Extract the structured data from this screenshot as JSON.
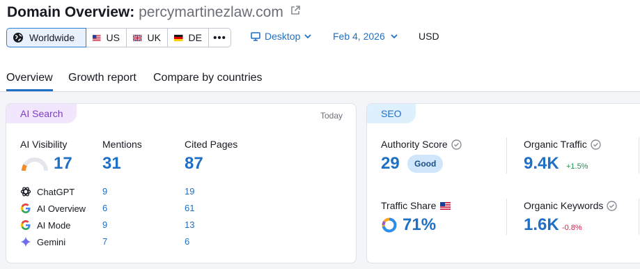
{
  "header": {
    "title": "Domain Overview:",
    "domain": "percymartinezlaw.com"
  },
  "databases": {
    "worldwide": "Worldwide",
    "us": "US",
    "uk": "UK",
    "de": "DE",
    "more": "•••"
  },
  "filters": {
    "device": "Desktop",
    "date": "Feb 4, 2026",
    "currency": "USD"
  },
  "tabs": {
    "overview": "Overview",
    "growth": "Growth report",
    "compare": "Compare by countries"
  },
  "ai_search": {
    "tag": "AI Search",
    "period": "Today",
    "visibility_label": "AI Visibility",
    "visibility_value": "17",
    "mentions_label": "Mentions",
    "mentions_value": "31",
    "cited_label": "Cited Pages",
    "cited_value": "87",
    "sources": [
      {
        "name": "ChatGPT",
        "mentions": "9",
        "cited": "19",
        "icon": "chatgpt-icon"
      },
      {
        "name": "AI Overview",
        "mentions": "6",
        "cited": "61",
        "icon": "google-icon"
      },
      {
        "name": "AI Mode",
        "mentions": "9",
        "cited": "13",
        "icon": "google-icon"
      },
      {
        "name": "Gemini",
        "mentions": "7",
        "cited": "6",
        "icon": "gemini-icon"
      }
    ]
  },
  "seo": {
    "tag": "SEO",
    "authority_label": "Authority Score",
    "authority_value": "29",
    "authority_badge": "Good",
    "organic_traffic_label": "Organic Traffic",
    "organic_traffic_value": "9.4K",
    "organic_traffic_delta": "+1.5%",
    "traffic_share_label": "Traffic Share",
    "traffic_share_value": "71%",
    "organic_keywords_label": "Organic Keywords",
    "organic_keywords_value": "1.6K",
    "organic_keywords_delta": "-0.8%"
  },
  "colors": {
    "accent": "#1f6fc4",
    "ai_tag_bg": "#f1e6fb",
    "ai_tag_text": "#7b3fc2",
    "seo_tag_bg": "#dff0fd",
    "seo_tag_text": "#1f6fc4",
    "positive": "#1e8f4e",
    "negative": "#d1204b"
  }
}
